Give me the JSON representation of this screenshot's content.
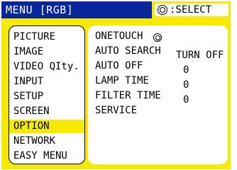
{
  "title_bar": {
    "menu_title": "MENU [RGB]",
    "select_hint": ":SELECT",
    "select_icon": "navigation-icon"
  },
  "colors": {
    "title_bg": "#06269a",
    "accent": "#f5ea00",
    "panel_bg": "#ffffff"
  },
  "left_menu": {
    "items": [
      {
        "label": "PICTURE"
      },
      {
        "label": "IMAGE"
      },
      {
        "label": "VIDEO QIty."
      },
      {
        "label": "INPUT"
      },
      {
        "label": "SETUP"
      },
      {
        "label": "SCREEN"
      },
      {
        "label": "OPTION"
      },
      {
        "label": "NETWORK"
      },
      {
        "label": "EASY MENU"
      }
    ],
    "selected": "OPTION"
  },
  "option_menu": {
    "items": [
      {
        "label": "ONETOUCH",
        "icon": "onetouch-icon"
      },
      {
        "label": "AUTO SEARCH",
        "value": "TURN OFF"
      },
      {
        "label": "AUTO OFF",
        "value": "0"
      },
      {
        "label": "LAMP TIME",
        "value": "0"
      },
      {
        "label": "FILTER TIME",
        "value": "0"
      },
      {
        "label": "SERVICE"
      }
    ]
  }
}
